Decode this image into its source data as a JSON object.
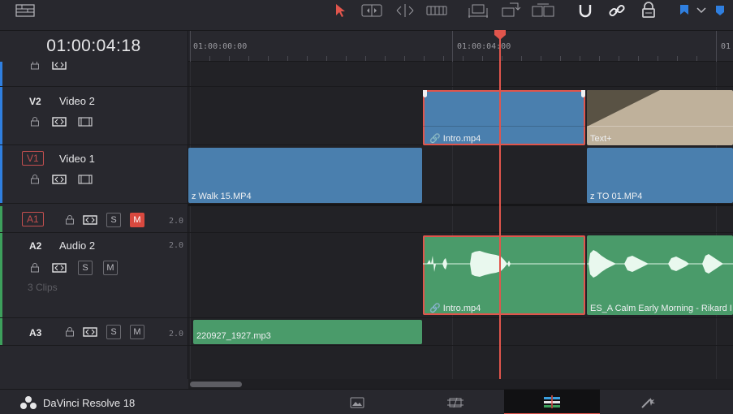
{
  "timecode": "01:00:04:18",
  "ruler": {
    "labels": [
      "01:00:00:00",
      "01:00:04:00",
      "01"
    ]
  },
  "tracks": {
    "v2": {
      "id": "V2",
      "name": "Video 2"
    },
    "v1": {
      "id": "V1",
      "name": "Video 1"
    },
    "a1": {
      "id": "A1",
      "channels": "2.0",
      "solo": "S",
      "mute": "M"
    },
    "a2": {
      "id": "A2",
      "name": "Audio 2",
      "channels": "2.0",
      "solo": "S",
      "mute": "M",
      "clips_count": "3 Clips"
    },
    "a3": {
      "id": "A3",
      "channels": "2.0",
      "solo": "S",
      "mute": "M"
    }
  },
  "clips": {
    "v2_intro": "Intro.mp4",
    "v2_text": "Text+",
    "v1_walk": "z Walk 15.MP4",
    "v1_to": "z TO 01.MP4",
    "a2_intro": "Intro.mp4",
    "a2_calm": "ES_A Calm Early Morning - Rikard I",
    "a3_clip": "220927_1927.mp3"
  },
  "bottombar": {
    "app_name": "DaVinci Resolve 18",
    "tabs": [
      "media-icon",
      "cut-icon",
      "edit-icon",
      "fusion-icon"
    ]
  },
  "colors": {
    "accent": "#e0554c",
    "video_clip": "#4a7fae",
    "audio_clip": "#4a9b6a",
    "title_clip": "#bfb19b",
    "marker": "#2f7fe0"
  },
  "icons": {
    "toolbar": [
      "timeline-view-icon",
      "selection-tool-icon",
      "trim-tool-icon",
      "dynamic-trim-icon",
      "blade-tool-icon",
      "insert-clip-icon",
      "overwrite-clip-icon",
      "replace-clip-icon",
      "snapping-icon",
      "linked-selection-icon",
      "position-lock-icon",
      "flag-icon",
      "flag-dropdown-icon",
      "marker-icon"
    ]
  }
}
